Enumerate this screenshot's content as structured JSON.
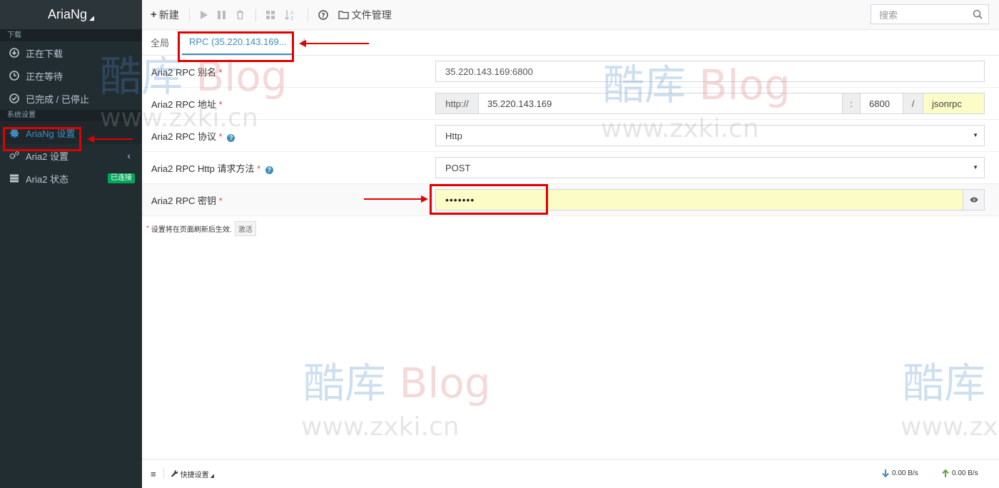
{
  "app": {
    "brand": "AriaNg"
  },
  "sidebar": {
    "section_download": "下载",
    "section_settings": "系统设置",
    "items": [
      {
        "label": "正在下载",
        "icon": "download-circle-icon"
      },
      {
        "label": "正在等待",
        "icon": "clock-icon"
      },
      {
        "label": "已完成 / 已停止",
        "icon": "check-circle-icon"
      },
      {
        "label": "AriaNg 设置",
        "icon": "gear-icon"
      },
      {
        "label": "Aria2 设置",
        "icon": "gears-icon"
      },
      {
        "label": "Aria2 状态",
        "icon": "server-icon",
        "badge": "已连接"
      }
    ]
  },
  "toolbar": {
    "new_label": "新建",
    "file_manager_label": "文件管理",
    "search_placeholder": "搜索"
  },
  "tabs": {
    "global": "全局",
    "rpc": "RPC (35.220.143.169..."
  },
  "form": {
    "alias": {
      "label": "Aria2 RPC 别名",
      "value": "35.220.143.169:6800"
    },
    "address": {
      "label": "Aria2 RPC 地址",
      "protocol_prefix": "http://",
      "host": "35.220.143.169",
      "colon": ":",
      "port": "6800",
      "slash": "/",
      "path": "jsonrpc"
    },
    "protocol": {
      "label": "Aria2 RPC 协议",
      "value": "Http"
    },
    "method": {
      "label": "Aria2 RPC Http 请求方法",
      "value": "POST"
    },
    "secret": {
      "label": "Aria2 RPC 密钥",
      "value": "•••••••"
    },
    "required_mark": "*"
  },
  "note": {
    "text": "设置将在页面刷新后生效.",
    "button": "激活"
  },
  "footer": {
    "quick_settings": "快捷设置",
    "download_speed": "0.00 B/s",
    "upload_speed": "0.00 B/s"
  },
  "watermark": {
    "cn": "酷库",
    "blog": "Blog",
    "url": "www.zxki.cn"
  },
  "colors": {
    "sidebar_bg": "#222d32",
    "accent": "#3c8dbc",
    "highlight": "#e00000",
    "badge_green": "#00a65a",
    "input_yellow": "#fcfcc7"
  }
}
